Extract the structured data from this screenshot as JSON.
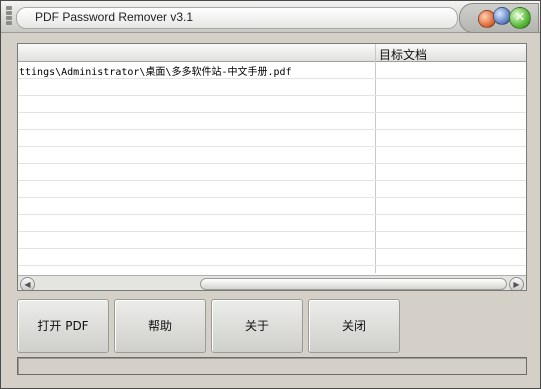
{
  "window": {
    "title": "PDF Password Remover v3.1"
  },
  "list": {
    "columns": [
      "",
      "目标文档"
    ],
    "rows": [
      [
        "ttings\\Administrator\\桌面\\多多软件站-中文手册.pdf",
        ""
      ]
    ]
  },
  "buttons": {
    "open_pdf": "打开 PDF",
    "help": "帮助",
    "about": "关于",
    "close": "关闭"
  },
  "titlebar_buttons": [
    "minimize-orb",
    "maximize-orb",
    "close-orb"
  ],
  "colors": {
    "close_orb": "#58b838",
    "min_orb": "#e07040",
    "max_orb": "#6888c8"
  }
}
